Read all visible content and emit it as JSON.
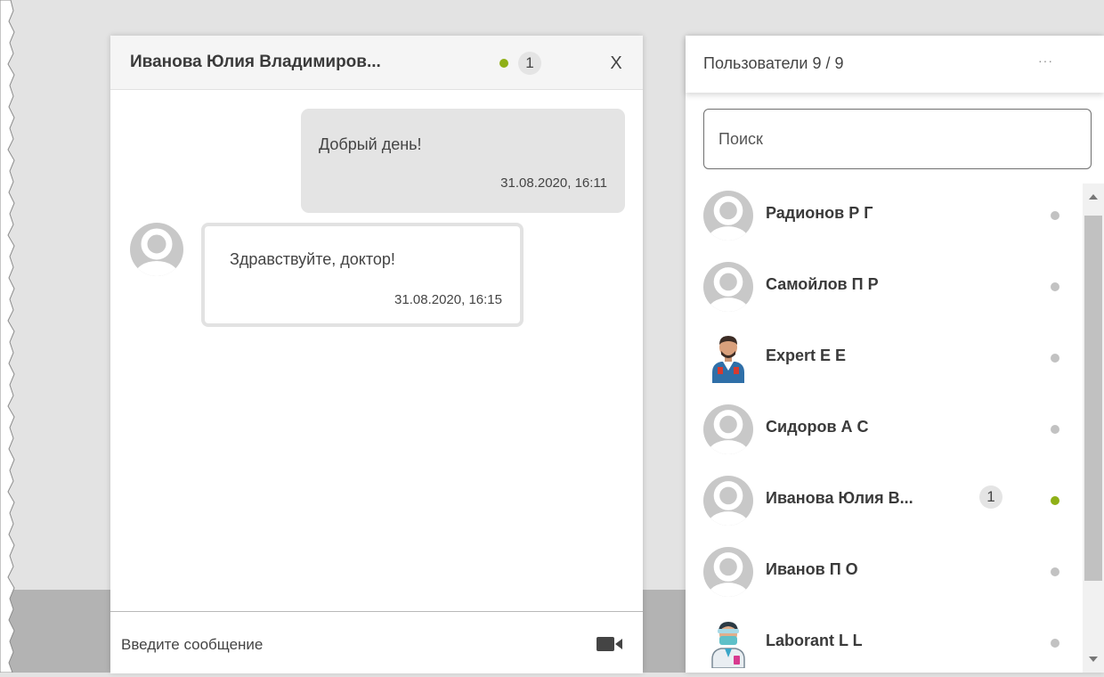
{
  "chat": {
    "title": "Иванова Юлия Владимиров...",
    "status": "online",
    "unread": "1",
    "close_label": "X",
    "messages": [
      {
        "direction": "outgoing",
        "text": "Добрый день!",
        "time": "31.08.2020, 16:11"
      },
      {
        "direction": "incoming",
        "text": "Здравствуйте, доктор!",
        "time": "31.08.2020, 16:15"
      }
    ],
    "input_placeholder": "Введите сообщение",
    "video_icon": "video-camera-icon"
  },
  "users_panel": {
    "title": "Пользователи 9 / 9",
    "more_label": "···",
    "search_placeholder": "Поиск",
    "users": [
      {
        "name": "Радионов Р Г",
        "status": "offline",
        "avatar": "default"
      },
      {
        "name": "Самойлов П Р",
        "status": "offline",
        "avatar": "default"
      },
      {
        "name": "Expert E E",
        "status": "offline",
        "avatar": "doctor"
      },
      {
        "name": "Сидоров А С",
        "status": "offline",
        "avatar": "default"
      },
      {
        "name": "Иванова Юлия В...",
        "status": "online",
        "avatar": "default",
        "unread": "1"
      },
      {
        "name": "Иванов П О",
        "status": "offline",
        "avatar": "default"
      },
      {
        "name": "Laborant L L",
        "status": "offline",
        "avatar": "laborant"
      }
    ]
  },
  "colors": {
    "online": "#8fb017",
    "offline": "#c2c2c2",
    "outgoing_bubble": "#e4e4e4",
    "header_bg": "#f5f5f5"
  }
}
